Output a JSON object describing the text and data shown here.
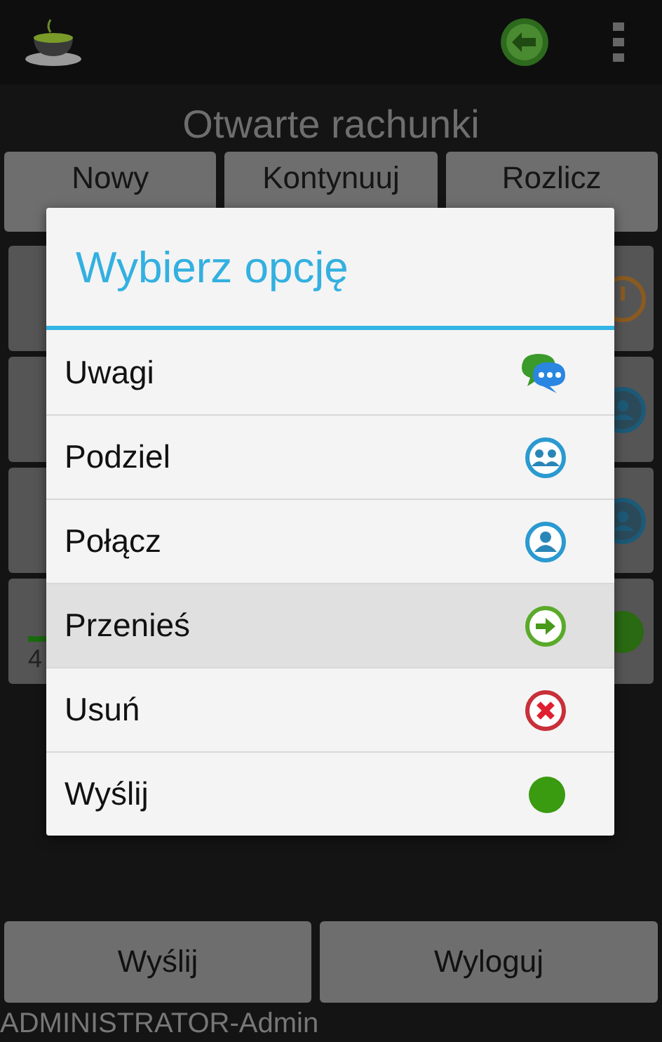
{
  "title": "Otwarte rachunki",
  "actions": [
    "Nowy",
    "Kontynuuj",
    "Rozlicz"
  ],
  "cards": [
    {
      "kind": "clock"
    },
    {
      "kind": "person"
    },
    {
      "kind": "person"
    },
    {
      "kind": "dot",
      "text": "4"
    }
  ],
  "dialog": {
    "title": "Wybierz opcję",
    "options": [
      {
        "label": "Uwagi",
        "kind": "comments",
        "selected": false
      },
      {
        "label": "Podziel",
        "kind": "split",
        "selected": false
      },
      {
        "label": "Połącz",
        "kind": "merge",
        "selected": false
      },
      {
        "label": "Przenieś",
        "kind": "move",
        "selected": true
      },
      {
        "label": "Usuń",
        "kind": "delete",
        "selected": false
      },
      {
        "label": "Wyślij",
        "kind": "send",
        "selected": false
      }
    ]
  },
  "bottom_buttons": [
    "Wyślij",
    "Wyloguj"
  ],
  "status": "ADMINISTRATOR-Admin"
}
